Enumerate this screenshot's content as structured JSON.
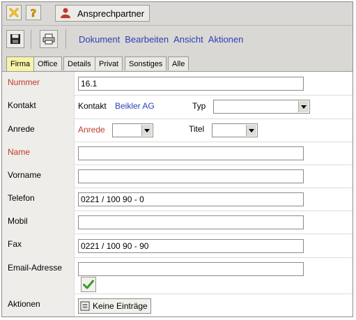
{
  "toolbar": {
    "title": "Ansprechpartner"
  },
  "menu": {
    "items": [
      "Dokument",
      "Bearbeiten",
      "Ansicht",
      "Aktionen"
    ]
  },
  "tabs": [
    "Firma",
    "Office",
    "Details",
    "Privat",
    "Sonstiges",
    "Alle"
  ],
  "active_tab": "Firma",
  "form": {
    "nummer": {
      "label": "Nummer",
      "value": "16.1"
    },
    "kontakt": {
      "label": "Kontakt",
      "prefix": "Kontakt",
      "link": "Beikler AG",
      "typ_label": "Typ",
      "typ_value": ""
    },
    "anrede": {
      "label": "Anrede",
      "inner_label": "Anrede",
      "value": "",
      "titel_label": "Titel",
      "titel_value": ""
    },
    "name": {
      "label": "Name",
      "value": ""
    },
    "vorname": {
      "label": "Vorname",
      "value": ""
    },
    "telefon": {
      "label": "Telefon",
      "value": "0221 / 100 90 - 0"
    },
    "mobil": {
      "label": "Mobil",
      "value": ""
    },
    "fax": {
      "label": "Fax",
      "value": "0221 / 100 90 - 90"
    },
    "email": {
      "label": "Email-Adresse",
      "value": ""
    },
    "aktionen": {
      "label": "Aktionen",
      "button": "Keine Einträge"
    }
  },
  "colors": {
    "required_label": "#c0392b",
    "link": "#2b3fb6",
    "active_tab": "#f6f2a8"
  }
}
